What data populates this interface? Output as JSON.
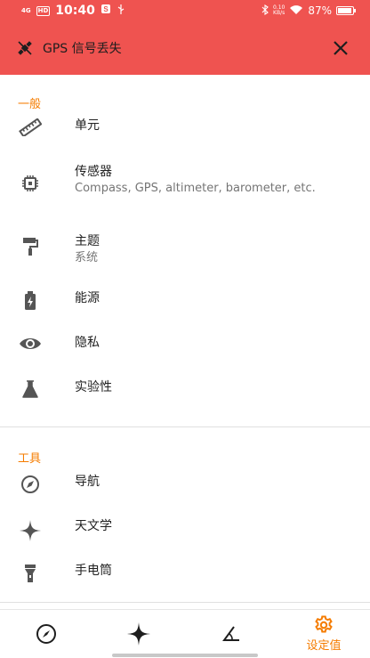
{
  "status_bar": {
    "network": "4G",
    "hd": "HD",
    "time": "10:40",
    "speed_value": "0.10",
    "speed_unit": "KB/s",
    "battery": "87%"
  },
  "alert": {
    "title": "GPS 信号丢失"
  },
  "sections": [
    {
      "title": "一般",
      "items": [
        {
          "icon": "ruler-icon",
          "label": "单元",
          "desc": ""
        },
        {
          "icon": "sensor-chip-icon",
          "label": "传感器",
          "desc": "Compass, GPS, altimeter, barometer, etc."
        },
        {
          "icon": "paint-roller-icon",
          "label": "主题",
          "desc": "系统"
        },
        {
          "icon": "battery-charging-icon",
          "label": "能源",
          "desc": ""
        },
        {
          "icon": "eye-icon",
          "label": "隐私",
          "desc": ""
        },
        {
          "icon": "flask-icon",
          "label": "实验性",
          "desc": ""
        }
      ]
    },
    {
      "title": "工具",
      "items": [
        {
          "icon": "compass-icon",
          "label": "导航",
          "desc": ""
        },
        {
          "icon": "star-icon",
          "label": "天文学",
          "desc": ""
        },
        {
          "icon": "flashlight-icon",
          "label": "手电筒",
          "desc": ""
        }
      ]
    }
  ],
  "bottom_nav": {
    "items": [
      {
        "icon": "compass-icon",
        "label": ""
      },
      {
        "icon": "sparkle-icon",
        "label": ""
      },
      {
        "icon": "angle-icon",
        "label": ""
      },
      {
        "icon": "gear-icon",
        "label": "设定值"
      }
    ],
    "active_color": "#f57c00"
  },
  "colors": {
    "alert_background": "#ef5350",
    "section_header": "#f57c00",
    "icon": "#555555"
  }
}
